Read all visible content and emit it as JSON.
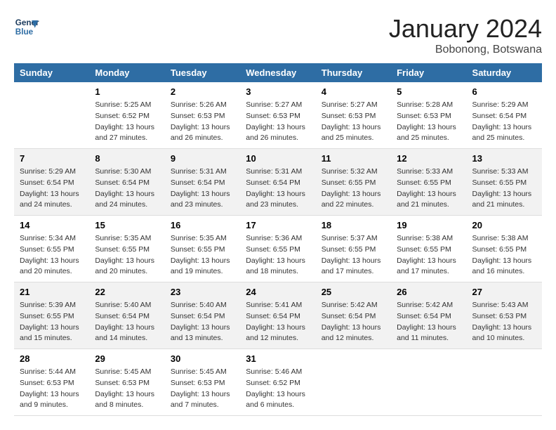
{
  "header": {
    "logo_line1": "General",
    "logo_line2": "Blue",
    "month": "January 2024",
    "location": "Bobonong, Botswana"
  },
  "days_of_week": [
    "Sunday",
    "Monday",
    "Tuesday",
    "Wednesday",
    "Thursday",
    "Friday",
    "Saturday"
  ],
  "weeks": [
    [
      {
        "num": "",
        "info": ""
      },
      {
        "num": "1",
        "info": "Sunrise: 5:25 AM\nSunset: 6:52 PM\nDaylight: 13 hours\nand 27 minutes."
      },
      {
        "num": "2",
        "info": "Sunrise: 5:26 AM\nSunset: 6:53 PM\nDaylight: 13 hours\nand 26 minutes."
      },
      {
        "num": "3",
        "info": "Sunrise: 5:27 AM\nSunset: 6:53 PM\nDaylight: 13 hours\nand 26 minutes."
      },
      {
        "num": "4",
        "info": "Sunrise: 5:27 AM\nSunset: 6:53 PM\nDaylight: 13 hours\nand 25 minutes."
      },
      {
        "num": "5",
        "info": "Sunrise: 5:28 AM\nSunset: 6:53 PM\nDaylight: 13 hours\nand 25 minutes."
      },
      {
        "num": "6",
        "info": "Sunrise: 5:29 AM\nSunset: 6:54 PM\nDaylight: 13 hours\nand 25 minutes."
      }
    ],
    [
      {
        "num": "7",
        "info": "Sunrise: 5:29 AM\nSunset: 6:54 PM\nDaylight: 13 hours\nand 24 minutes."
      },
      {
        "num": "8",
        "info": "Sunrise: 5:30 AM\nSunset: 6:54 PM\nDaylight: 13 hours\nand 24 minutes."
      },
      {
        "num": "9",
        "info": "Sunrise: 5:31 AM\nSunset: 6:54 PM\nDaylight: 13 hours\nand 23 minutes."
      },
      {
        "num": "10",
        "info": "Sunrise: 5:31 AM\nSunset: 6:54 PM\nDaylight: 13 hours\nand 23 minutes."
      },
      {
        "num": "11",
        "info": "Sunrise: 5:32 AM\nSunset: 6:55 PM\nDaylight: 13 hours\nand 22 minutes."
      },
      {
        "num": "12",
        "info": "Sunrise: 5:33 AM\nSunset: 6:55 PM\nDaylight: 13 hours\nand 21 minutes."
      },
      {
        "num": "13",
        "info": "Sunrise: 5:33 AM\nSunset: 6:55 PM\nDaylight: 13 hours\nand 21 minutes."
      }
    ],
    [
      {
        "num": "14",
        "info": "Sunrise: 5:34 AM\nSunset: 6:55 PM\nDaylight: 13 hours\nand 20 minutes."
      },
      {
        "num": "15",
        "info": "Sunrise: 5:35 AM\nSunset: 6:55 PM\nDaylight: 13 hours\nand 20 minutes."
      },
      {
        "num": "16",
        "info": "Sunrise: 5:35 AM\nSunset: 6:55 PM\nDaylight: 13 hours\nand 19 minutes."
      },
      {
        "num": "17",
        "info": "Sunrise: 5:36 AM\nSunset: 6:55 PM\nDaylight: 13 hours\nand 18 minutes."
      },
      {
        "num": "18",
        "info": "Sunrise: 5:37 AM\nSunset: 6:55 PM\nDaylight: 13 hours\nand 17 minutes."
      },
      {
        "num": "19",
        "info": "Sunrise: 5:38 AM\nSunset: 6:55 PM\nDaylight: 13 hours\nand 17 minutes."
      },
      {
        "num": "20",
        "info": "Sunrise: 5:38 AM\nSunset: 6:55 PM\nDaylight: 13 hours\nand 16 minutes."
      }
    ],
    [
      {
        "num": "21",
        "info": "Sunrise: 5:39 AM\nSunset: 6:55 PM\nDaylight: 13 hours\nand 15 minutes."
      },
      {
        "num": "22",
        "info": "Sunrise: 5:40 AM\nSunset: 6:54 PM\nDaylight: 13 hours\nand 14 minutes."
      },
      {
        "num": "23",
        "info": "Sunrise: 5:40 AM\nSunset: 6:54 PM\nDaylight: 13 hours\nand 13 minutes."
      },
      {
        "num": "24",
        "info": "Sunrise: 5:41 AM\nSunset: 6:54 PM\nDaylight: 13 hours\nand 12 minutes."
      },
      {
        "num": "25",
        "info": "Sunrise: 5:42 AM\nSunset: 6:54 PM\nDaylight: 13 hours\nand 12 minutes."
      },
      {
        "num": "26",
        "info": "Sunrise: 5:42 AM\nSunset: 6:54 PM\nDaylight: 13 hours\nand 11 minutes."
      },
      {
        "num": "27",
        "info": "Sunrise: 5:43 AM\nSunset: 6:53 PM\nDaylight: 13 hours\nand 10 minutes."
      }
    ],
    [
      {
        "num": "28",
        "info": "Sunrise: 5:44 AM\nSunset: 6:53 PM\nDaylight: 13 hours\nand 9 minutes."
      },
      {
        "num": "29",
        "info": "Sunrise: 5:45 AM\nSunset: 6:53 PM\nDaylight: 13 hours\nand 8 minutes."
      },
      {
        "num": "30",
        "info": "Sunrise: 5:45 AM\nSunset: 6:53 PM\nDaylight: 13 hours\nand 7 minutes."
      },
      {
        "num": "31",
        "info": "Sunrise: 5:46 AM\nSunset: 6:52 PM\nDaylight: 13 hours\nand 6 minutes."
      },
      {
        "num": "",
        "info": ""
      },
      {
        "num": "",
        "info": ""
      },
      {
        "num": "",
        "info": ""
      }
    ]
  ]
}
